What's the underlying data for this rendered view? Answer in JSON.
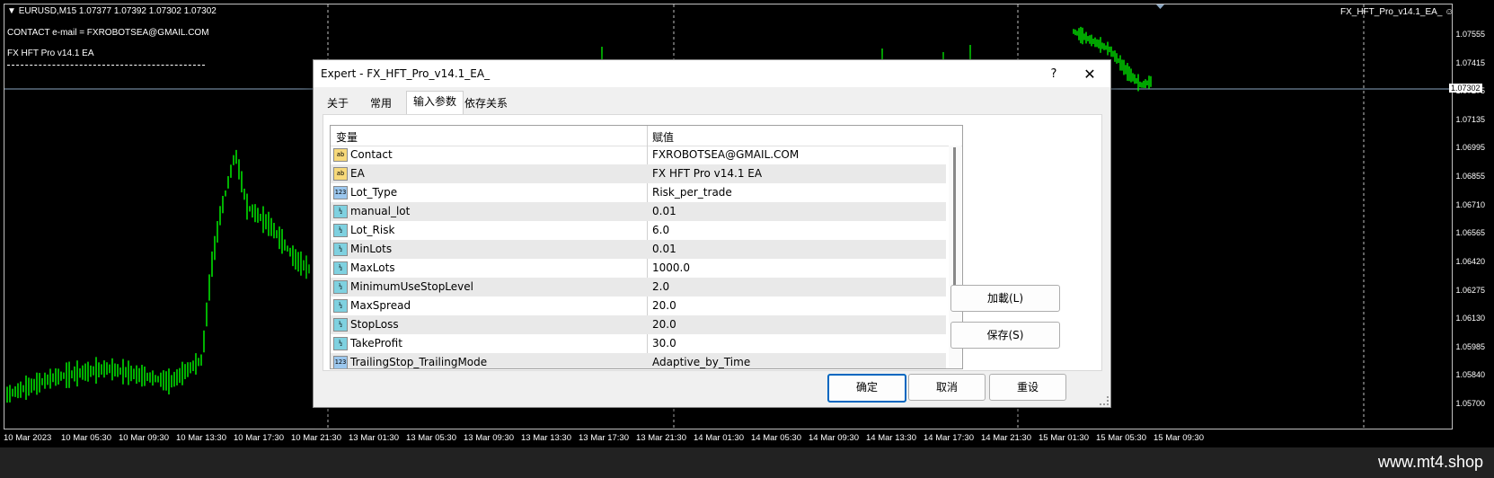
{
  "chart": {
    "symbol_line": "EURUSD,M15  1.07377 1.07392 1.07302 1.07302",
    "contact_line": "CONTACT e-mail = FXROBOTSEA@GMAIL.COM",
    "ea_line": "FX HFT Pro v14.1 EA",
    "ea_corner": "FX_HFT_Pro_v14.1_EA_",
    "current_price": "1.07302",
    "price_labels": [
      "1.07555",
      "1.07415",
      "1.07275",
      "1.07135",
      "1.06995",
      "1.06855",
      "1.06710",
      "1.06565",
      "1.06420",
      "1.06275",
      "1.06130",
      "1.05985",
      "1.05840",
      "1.05700"
    ],
    "time_labels": [
      "10 Mar 2023",
      "10 Mar 05:30",
      "10 Mar 09:30",
      "10 Mar 13:30",
      "10 Mar 17:30",
      "10 Mar 21:30",
      "13 Mar 01:30",
      "13 Mar 05:30",
      "13 Mar 09:30",
      "13 Mar 13:30",
      "13 Mar 17:30",
      "13 Mar 21:30",
      "14 Mar 01:30",
      "14 Mar 05:30",
      "14 Mar 09:30",
      "14 Mar 13:30",
      "14 Mar 17:30",
      "14 Mar 21:30",
      "15 Mar 01:30",
      "15 Mar 05:30",
      "15 Mar 09:30"
    ],
    "colors": {
      "background": "#000000",
      "candles": "#00ff00",
      "grid": "#c0c0c0"
    }
  },
  "dialog": {
    "title": "Expert - FX_HFT_Pro_v14.1_EA_",
    "help": "?",
    "close": "✕",
    "tabs": [
      "关于",
      "常用",
      "输入参数",
      "依存关系"
    ],
    "active_tab": "输入参数",
    "grid": {
      "col_var": "变量",
      "col_val": "赋值",
      "rows": [
        {
          "icon": "ab",
          "icon_text": "ab",
          "name": "Contact",
          "value": "FXROBOTSEA@GMAIL.COM"
        },
        {
          "icon": "ab",
          "icon_text": "ab",
          "name": "EA",
          "value": "FX HFT Pro v14.1 EA"
        },
        {
          "icon": "num",
          "icon_text": "123",
          "name": "Lot_Type",
          "value": "Risk_per_trade"
        },
        {
          "icon": "v2",
          "icon_text": "½",
          "name": "manual_lot",
          "value": "0.01"
        },
        {
          "icon": "v2",
          "icon_text": "½",
          "name": "Lot_Risk",
          "value": "6.0"
        },
        {
          "icon": "v2",
          "icon_text": "½",
          "name": "MinLots",
          "value": "0.01"
        },
        {
          "icon": "v2",
          "icon_text": "½",
          "name": "MaxLots",
          "value": "1000.0"
        },
        {
          "icon": "v2",
          "icon_text": "½",
          "name": "MinimumUseStopLevel",
          "value": "2.0"
        },
        {
          "icon": "v2",
          "icon_text": "½",
          "name": "MaxSpread",
          "value": "20.0"
        },
        {
          "icon": "v2",
          "icon_text": "½",
          "name": "StopLoss",
          "value": "20.0"
        },
        {
          "icon": "v2",
          "icon_text": "½",
          "name": "TakeProfit",
          "value": "30.0"
        },
        {
          "icon": "num",
          "icon_text": "123",
          "name": "TrailingStop_TrailingMode",
          "value": "Adaptive_by_Time"
        }
      ]
    },
    "load_button": "加載(L)",
    "save_button": "保存(S)",
    "ok_button": "确定",
    "cancel_button": "取消",
    "reset_button": "重设"
  },
  "footer": {
    "watermark": "www.mt4.shop"
  }
}
